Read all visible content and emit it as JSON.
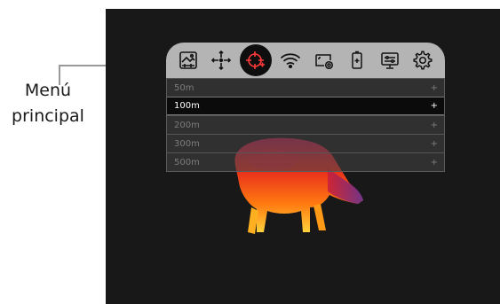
{
  "callout": {
    "line1": "Menú",
    "line2": "principal"
  },
  "menu": {
    "icons": [
      {
        "name": "image-settings-icon",
        "active": false
      },
      {
        "name": "crosshair-move-icon",
        "active": false
      },
      {
        "name": "reticle-icon",
        "active": true
      },
      {
        "name": "wifi-icon",
        "active": false
      },
      {
        "name": "video-record-icon",
        "active": false
      },
      {
        "name": "battery-icon",
        "active": false
      },
      {
        "name": "display-settings-icon",
        "active": false
      },
      {
        "name": "gear-icon",
        "active": false
      }
    ],
    "distances": [
      {
        "label": "50m",
        "plus": "+",
        "selected": false
      },
      {
        "label": "100m",
        "plus": "+",
        "selected": true
      },
      {
        "label": "200m",
        "plus": "+",
        "selected": false
      },
      {
        "label": "300m",
        "plus": "+",
        "selected": false
      },
      {
        "label": "500m",
        "plus": "+",
        "selected": false
      }
    ]
  },
  "colors": {
    "screen_bg": "#181818",
    "menu_bar": "#b4b4b4",
    "selected_row": "#0b0b0b"
  }
}
